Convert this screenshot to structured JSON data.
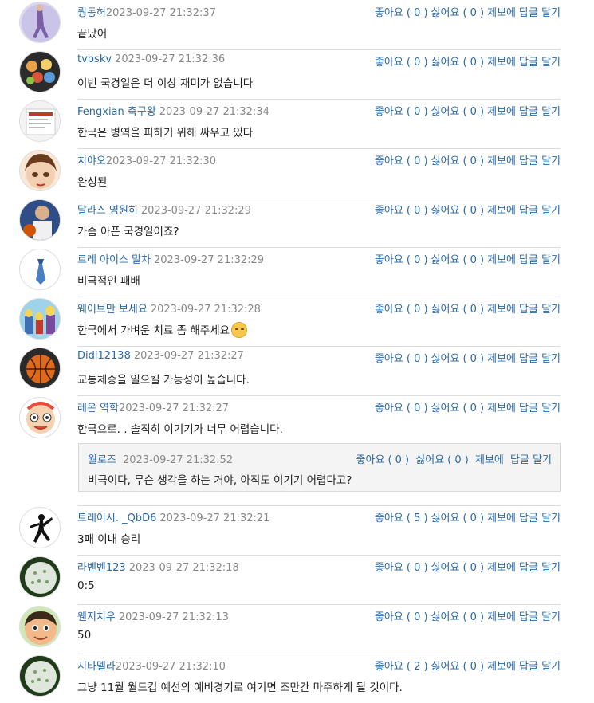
{
  "actions": {
    "like": "좋아요",
    "dislike": "싫어요",
    "report": "제보에",
    "reply": "답글 달기"
  },
  "comments": [
    {
      "name": "뤙동허",
      "time": "2023-09-27 21:32:37",
      "text": "끝났어",
      "likes": "( 0 )",
      "dislikes": "( 0 )",
      "avatar": "figure-skater"
    },
    {
      "name": "tvbskv",
      "time": "2023-09-27 21:32:36",
      "text": "이번 국경일은 더 이상 재미가 없습니다",
      "likes": "( 0 )",
      "dislikes": "( 0 )",
      "avatar": "cartoon-group"
    },
    {
      "name": "Fengxian 축구왕",
      "time": "2023-09-27 21:32:34",
      "text": "한국은 병역을 피하기 위해 싸우고 있다",
      "likes": "( 0 )",
      "dislikes": "( 0 )",
      "avatar": "document"
    },
    {
      "name": "치야오",
      "time": "2023-09-27 21:32:30",
      "text": "완성된",
      "likes": "( 0 )",
      "dislikes": "( 0 )",
      "avatar": "anime-face"
    },
    {
      "name": "달라스 영원히",
      "time": "2023-09-27 21:32:29",
      "text": "가슴 아픈 국경일이죠?",
      "likes": "( 0 )",
      "dislikes": "( 0 )",
      "avatar": "basketball-player"
    },
    {
      "name": "르레 아이스 말차",
      "time": "2023-09-27 21:32:29",
      "text": "비극적인 패배",
      "likes": "( 0 )",
      "dislikes": "( 0 )",
      "avatar": "tie"
    },
    {
      "name": "웨이브만 보세요",
      "time": "2023-09-27 21:32:28",
      "text": "한국에서 가벼운 치료 좀 해주세요",
      "likes": "( 0 )",
      "dislikes": "( 0 )",
      "avatar": "cartoon-family",
      "emoji": true
    },
    {
      "name": "Didi12138",
      "time": "2023-09-27 21:32:27",
      "text": "교통체증을 일으킬 가능성이 높습니다.",
      "likes": "( 0 )",
      "dislikes": "( 0 )",
      "avatar": "basketball"
    },
    {
      "name": "레온 역학",
      "time": "2023-09-27 21:32:27",
      "text": "한국으로. . 솔직히 이기기가 너무 어렵습니다.",
      "likes": "( 0 )",
      "dislikes": "( 0 )",
      "avatar": "cartoon-doctor"
    },
    {
      "name": "트레이시. _QbD6",
      "time": "2023-09-27 21:32:21",
      "text": "3패 이내 승리",
      "likes": "( 5 )",
      "dislikes": "( 0 )",
      "avatar": "jumpman"
    },
    {
      "name": "라벤벤123",
      "time": "2023-09-27 21:32:18",
      "text": "0:5",
      "likes": "( 0 )",
      "dislikes": "( 0 )",
      "avatar": "green-sphere"
    },
    {
      "name": "웬지치우",
      "time": "2023-09-27 21:32:13",
      "text": "50",
      "likes": "( 0 )",
      "dislikes": "( 0 )",
      "avatar": "cartoon-boy"
    },
    {
      "name": "시타델라",
      "time": "2023-09-27 21:32:10",
      "text": "그냥 11월 월드컵 예선의 예비경기로 여기면 조만간 마주하게 될 것이다.",
      "likes": "( 2 )",
      "dislikes": "( 0 )",
      "avatar": "green-sphere"
    }
  ],
  "reply": {
    "name": "월로즈",
    "time": "2023-09-27 21:32:52",
    "text": "비극이다, 무슨 생각을 하는 거야, 아직도 이기기 어렵다고?",
    "likes": "( 0 )",
    "dislikes": "( 0 )"
  }
}
